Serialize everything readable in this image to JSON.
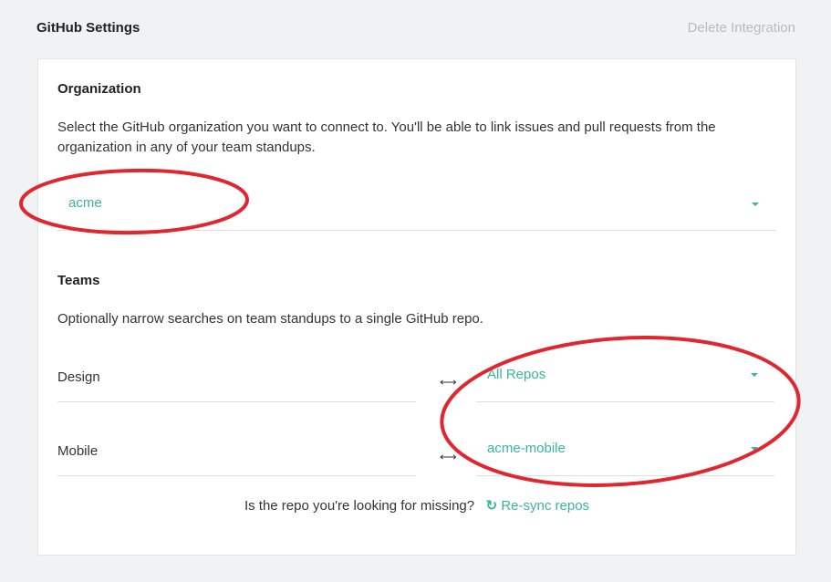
{
  "header": {
    "title": "GitHub Settings",
    "delete_label": "Delete Integration"
  },
  "organization": {
    "title": "Organization",
    "description": "Select the GitHub organization you want to connect to. You'll be able to link issues and pull requests from the organization in any of your team standups.",
    "selected": "acme"
  },
  "teams": {
    "title": "Teams",
    "description": "Optionally narrow searches on team standups to a single GitHub repo.",
    "rows": [
      {
        "name": "Design",
        "repo": "All Repos"
      },
      {
        "name": "Mobile",
        "repo": "acme-mobile"
      }
    ]
  },
  "footer": {
    "question": "Is the repo you're looking for missing?",
    "resync_label": "Re-sync repos"
  },
  "colors": {
    "accent": "#3db39e",
    "annotation": "#e0262f",
    "muted": "#b6bcc2"
  },
  "icons": [
    "swap-horizontal-icon",
    "refresh-icon",
    "chevron-down-icon"
  ]
}
